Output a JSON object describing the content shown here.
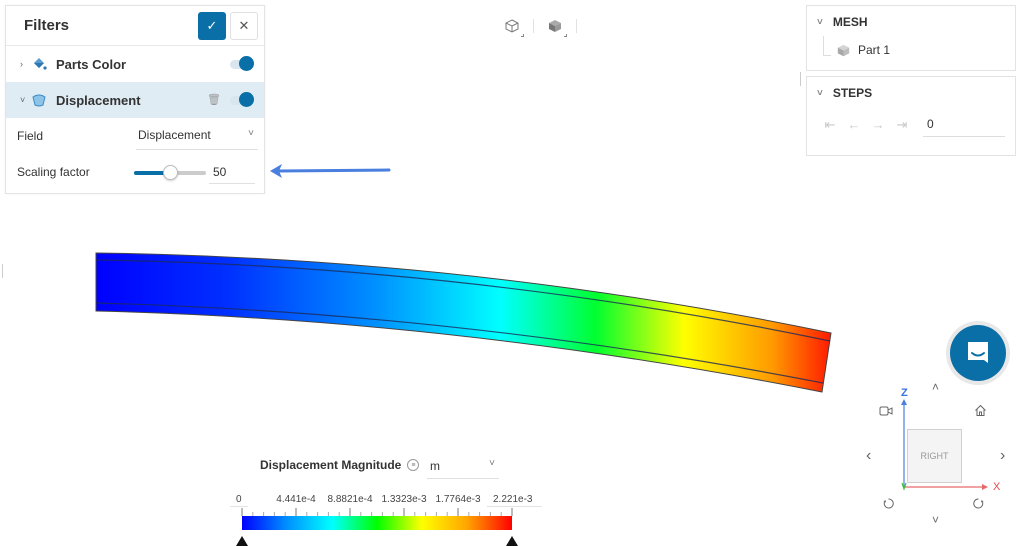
{
  "filters": {
    "title": "Filters",
    "confirm_icon": "check-icon",
    "close_icon": "close-icon",
    "items": [
      {
        "label": "Parts Color",
        "icon": "paint-bucket-icon",
        "expanded": false,
        "enabled": true
      },
      {
        "label": "Displacement",
        "icon": "displacement-icon",
        "expanded": true,
        "enabled": true
      }
    ],
    "properties": {
      "field_label": "Field",
      "field_value": "Displacement",
      "scaling_label": "Scaling factor",
      "scaling_value": "50",
      "scaling_fraction": 0.5
    }
  },
  "view_toolbar": {
    "buttons": [
      {
        "name": "wireframe-cube-icon"
      },
      {
        "name": "solid-cube-icon"
      }
    ]
  },
  "mesh_panel": {
    "title": "MESH",
    "items": [
      {
        "label": "Part 1",
        "icon": "cube-icon"
      }
    ]
  },
  "steps_panel": {
    "title": "STEPS",
    "nav": {
      "first": "⇤",
      "prev": "←",
      "next": "→",
      "last": "⇥"
    },
    "value": "0"
  },
  "legend": {
    "title": "Displacement Magnitude",
    "unit": "m",
    "ticks": [
      "0",
      "4.441e-4",
      "8.8821e-4",
      "1.3323e-3",
      "1.7764e-3",
      "2.221e-3"
    ],
    "min": 0,
    "max": 0.002221,
    "colormap": [
      "#0000ff",
      "#0090ff",
      "#00ffff",
      "#00ff00",
      "#ffff00",
      "#ffa500",
      "#ff0000"
    ]
  },
  "nav_cube": {
    "face_label": "RIGHT",
    "axis_z": "Z",
    "axis_x": "X",
    "icons": {
      "up": "˄",
      "down": "˅",
      "left": "‹",
      "right": "›"
    }
  },
  "colors": {
    "accent": "#0a6fa6",
    "annotation_arrow": "#4a7fe0",
    "active_row": "#dfecf4"
  }
}
